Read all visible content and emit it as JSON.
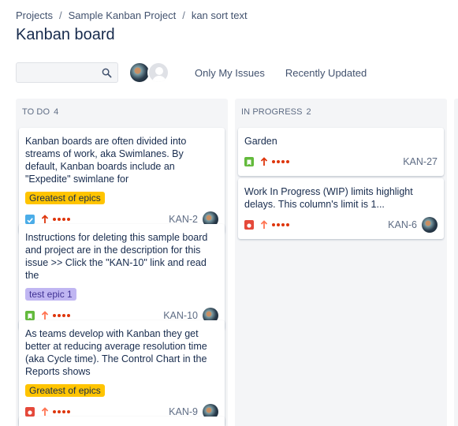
{
  "breadcrumb": {
    "items": [
      "Projects",
      "Sample Kanban Project",
      "kan sort text"
    ],
    "separator": "/"
  },
  "page": {
    "title": "Kanban board"
  },
  "toolbar": {
    "search": {
      "value": "",
      "placeholder": ""
    },
    "filters": [
      "Only My Issues",
      "Recently Updated"
    ]
  },
  "columns": [
    {
      "title": "TO DO",
      "count": "4",
      "cards": [
        {
          "summary": "Kanban boards are often divided into streams of work, aka Swimlanes. By default, Kanban boards include an \"Expedite\" swimlane for",
          "epic": "Greatest of epics",
          "epic_color": "#ffc400",
          "type": "task-icon",
          "priority": "high-priority-arrow-icon",
          "key": "KAN-2"
        },
        {
          "summary": "Instructions for deleting this sample board and project are in the description for this issue >> Click the \"KAN-10\" link and read the",
          "epic": "test epic 1",
          "epic_color": "#c0b6f2",
          "type": "story-icon",
          "priority": "medium-priority-arrow-icon",
          "key": "KAN-10"
        },
        {
          "summary": "As teams develop with Kanban they get better at reducing average resolution time (aka Cycle time). The Control Chart in the Reports shows",
          "epic": "Greatest of epics",
          "epic_color": "#ffc400",
          "type": "bug-icon",
          "priority": "medium-priority-arrow-icon",
          "key": "KAN-9"
        }
      ]
    },
    {
      "title": "IN PROGRESS",
      "count": "2",
      "cards": [
        {
          "summary": "Garden",
          "type": "story-icon",
          "priority": "high-priority-arrow-icon",
          "key": "KAN-27"
        },
        {
          "summary": "Work In Progress (WIP) limits highlight delays. This column's limit is 1...",
          "type": "bug-icon",
          "priority": "medium-priority-arrow-icon",
          "key": "KAN-6"
        }
      ]
    }
  ],
  "colors": {
    "priority_high": "#de350b",
    "priority_medium": "#ff7452",
    "column_bg": "#f4f5f7"
  }
}
